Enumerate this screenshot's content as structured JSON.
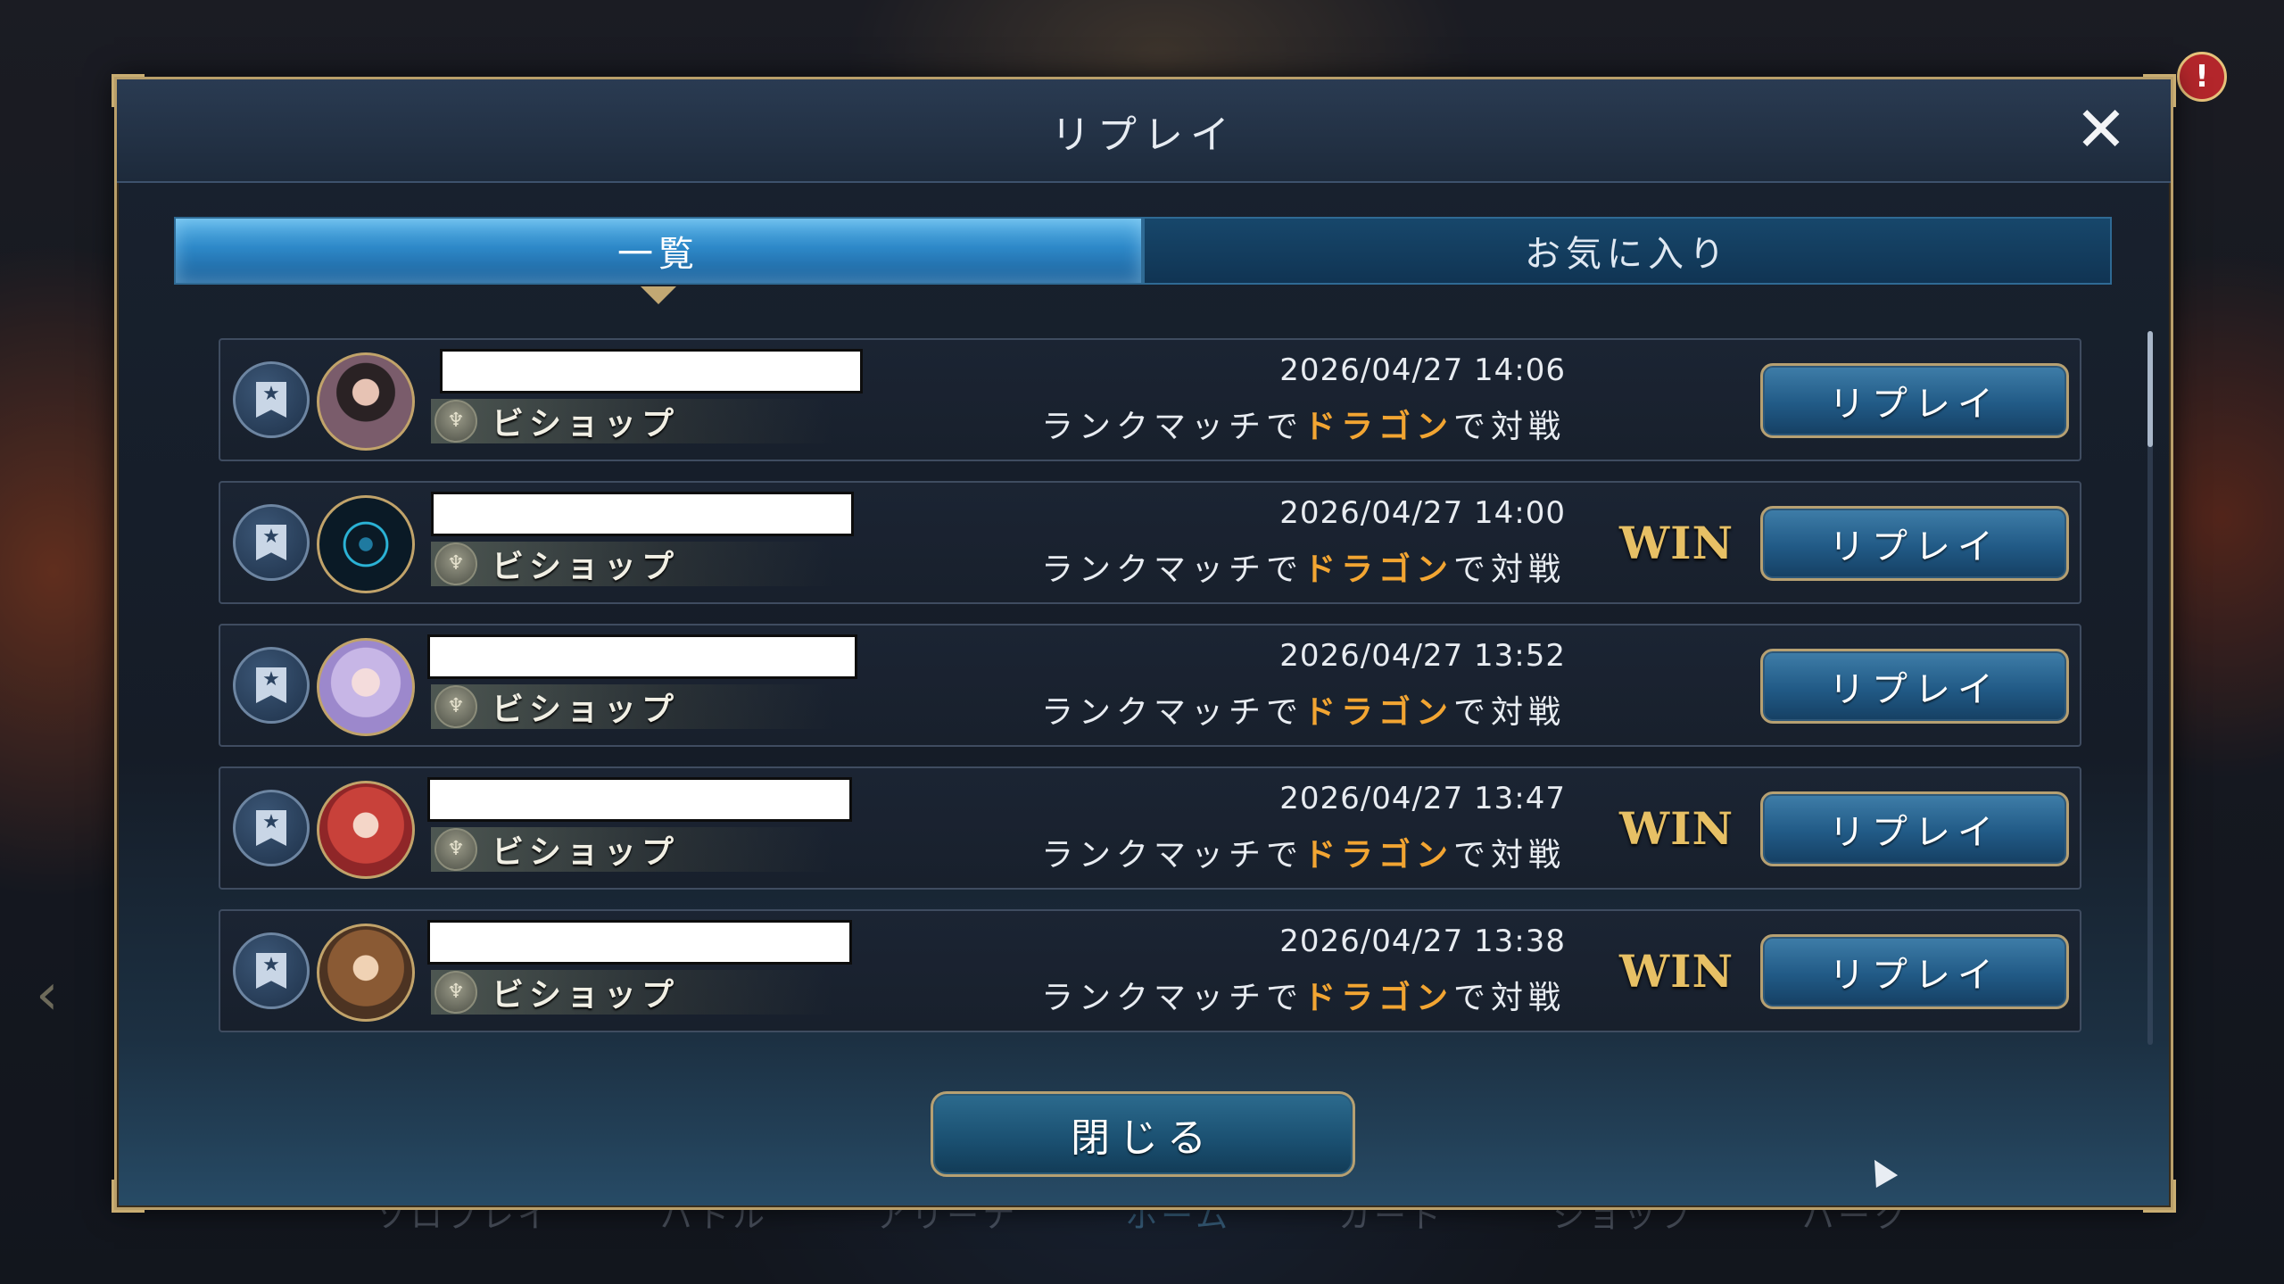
{
  "modal": {
    "title": "リプレイ",
    "close_label": "閉じる"
  },
  "tabs": [
    {
      "label": "一覧",
      "active": true
    },
    {
      "label": "お気に入り",
      "active": false
    }
  ],
  "replays": [
    {
      "opponent_class": "ビショップ",
      "datetime": "2026/04/27 14:06",
      "desc_pre": "ランクマッチで",
      "desc_hl": "ドラゴン",
      "desc_post": "で対戦",
      "result": "",
      "button": "リプレイ"
    },
    {
      "opponent_class": "ビショップ",
      "datetime": "2026/04/27 14:00",
      "desc_pre": "ランクマッチで",
      "desc_hl": "ドラゴン",
      "desc_post": "で対戦",
      "result": "WIN",
      "button": "リプレイ"
    },
    {
      "opponent_class": "ビショップ",
      "datetime": "2026/04/27 13:52",
      "desc_pre": "ランクマッチで",
      "desc_hl": "ドラゴン",
      "desc_post": "で対戦",
      "result": "",
      "button": "リプレイ"
    },
    {
      "opponent_class": "ビショップ",
      "datetime": "2026/04/27 13:47",
      "desc_pre": "ランクマッチで",
      "desc_hl": "ドラゴン",
      "desc_post": "で対戦",
      "result": "WIN",
      "button": "リプレイ"
    },
    {
      "opponent_class": "ビショップ",
      "datetime": "2026/04/27 13:38",
      "desc_pre": "ランクマッチで",
      "desc_hl": "ドラゴン",
      "desc_post": "で対戦",
      "result": "WIN",
      "button": "リプレイ"
    }
  ],
  "background_nav": [
    "ソロプレイ",
    "バトル",
    "アリーナ",
    "ホーム",
    "カード",
    "ショップ",
    "パーク"
  ],
  "colors": {
    "highlight": "#f2a532",
    "win": "#e7c065",
    "accent_blue": "#2d88c8",
    "gold_border": "#b99f6a"
  },
  "icons": {
    "close": "close-icon",
    "favorite": "bookmark-star-icon",
    "class": "bishop-class-icon"
  }
}
